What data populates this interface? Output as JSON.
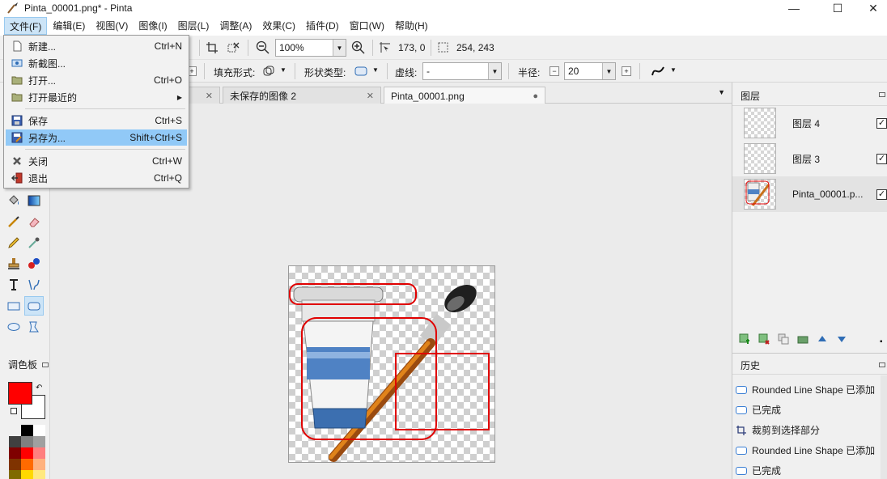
{
  "window": {
    "title": "Pinta_00001.png* - Pinta",
    "minimize": "—",
    "maximize": "☐",
    "close": "✕"
  },
  "menubar": {
    "items": [
      "文件(F)",
      "编辑(E)",
      "视图(V)",
      "图像(I)",
      "图层(L)",
      "调整(A)",
      "效果(C)",
      "插件(D)",
      "窗口(W)",
      "帮助(H)"
    ]
  },
  "toolbar1": {
    "zoom_value": "100%",
    "cursor_position": "173, 0",
    "selection_size": "254, 243"
  },
  "toolbar2": {
    "fill_label": "填充形式:",
    "shape_type_label": "形状类型:",
    "dash_label": "虚线:",
    "dash_value": "-",
    "radius_label": "半径:",
    "radius_value": "20"
  },
  "file_menu": {
    "items": [
      {
        "label": "新建...",
        "shortcut": "Ctrl+N",
        "icon": "new-file-icon"
      },
      {
        "label": "新截图...",
        "shortcut": "",
        "icon": "screenshot-icon"
      },
      {
        "label": "打开...",
        "shortcut": "Ctrl+O",
        "icon": "open-folder-icon"
      },
      {
        "label": "打开最近的",
        "shortcut": "▶",
        "icon": "recent-folder-icon"
      },
      {
        "label": "保存",
        "shortcut": "Ctrl+S",
        "icon": "save-icon"
      },
      {
        "label": "另存为...",
        "shortcut": "Shift+Ctrl+S",
        "icon": "save-as-icon"
      },
      {
        "label": "关闭",
        "shortcut": "Ctrl+W",
        "icon": "close-doc-icon"
      },
      {
        "label": "退出",
        "shortcut": "Ctrl+Q",
        "icon": "exit-icon"
      }
    ]
  },
  "tabs": [
    {
      "label": "",
      "close": "✕"
    },
    {
      "label": "未保存的图像 2",
      "close": "✕"
    },
    {
      "label": "Pinta_00001.png",
      "close": "●"
    }
  ],
  "palette": {
    "title": "调色板",
    "primary_color": "#ff0000",
    "secondary_color": "#ffffff"
  },
  "layers_panel": {
    "title": "图层",
    "layers": [
      {
        "name": "图层 4",
        "visible": "✓"
      },
      {
        "name": "图层 3",
        "visible": "✓"
      },
      {
        "name": "Pinta_00001.p...",
        "visible": "✓"
      }
    ]
  },
  "history_panel": {
    "title": "历史",
    "items": [
      {
        "label": "Rounded Line Shape 已添加"
      },
      {
        "label": "已完成"
      },
      {
        "label": "裁剪到选择部分"
      },
      {
        "label": "Rounded Line Shape 已添加"
      },
      {
        "label": "已完成"
      }
    ]
  },
  "colors": {
    "accent": "#91c9f7",
    "shape_outline": "#e00000"
  }
}
